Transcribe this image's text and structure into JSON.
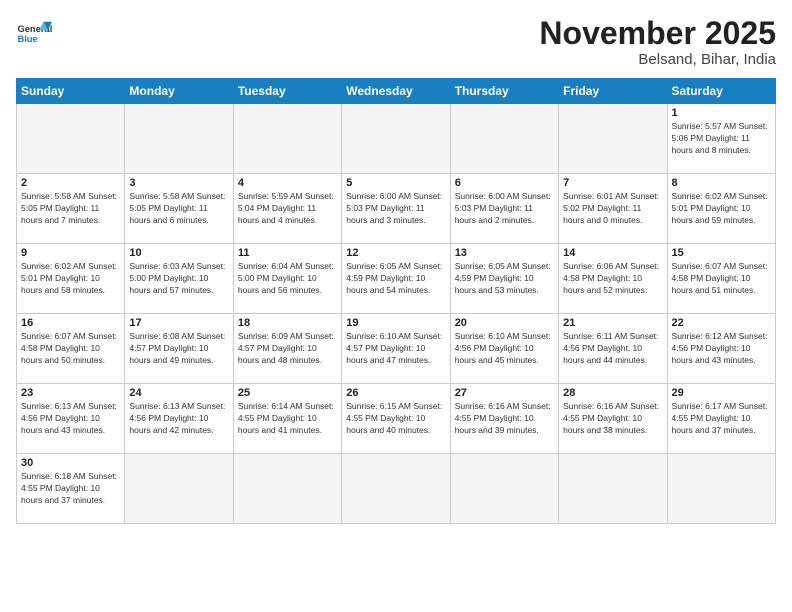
{
  "logo": {
    "general": "General",
    "blue": "Blue"
  },
  "title": "November 2025",
  "subtitle": "Belsand, Bihar, India",
  "days_of_week": [
    "Sunday",
    "Monday",
    "Tuesday",
    "Wednesday",
    "Thursday",
    "Friday",
    "Saturday"
  ],
  "weeks": [
    [
      {
        "day": "",
        "info": ""
      },
      {
        "day": "",
        "info": ""
      },
      {
        "day": "",
        "info": ""
      },
      {
        "day": "",
        "info": ""
      },
      {
        "day": "",
        "info": ""
      },
      {
        "day": "",
        "info": ""
      },
      {
        "day": "1",
        "info": "Sunrise: 5:57 AM\nSunset: 5:06 PM\nDaylight: 11 hours\nand 8 minutes."
      }
    ],
    [
      {
        "day": "2",
        "info": "Sunrise: 5:58 AM\nSunset: 5:05 PM\nDaylight: 11 hours\nand 7 minutes."
      },
      {
        "day": "3",
        "info": "Sunrise: 5:58 AM\nSunset: 5:05 PM\nDaylight: 11 hours\nand 6 minutes."
      },
      {
        "day": "4",
        "info": "Sunrise: 5:59 AM\nSunset: 5:04 PM\nDaylight: 11 hours\nand 4 minutes."
      },
      {
        "day": "5",
        "info": "Sunrise: 6:00 AM\nSunset: 5:03 PM\nDaylight: 11 hours\nand 3 minutes."
      },
      {
        "day": "6",
        "info": "Sunrise: 6:00 AM\nSunset: 5:03 PM\nDaylight: 11 hours\nand 2 minutes."
      },
      {
        "day": "7",
        "info": "Sunrise: 6:01 AM\nSunset: 5:02 PM\nDaylight: 11 hours\nand 0 minutes."
      },
      {
        "day": "8",
        "info": "Sunrise: 6:02 AM\nSunset: 5:01 PM\nDaylight: 10 hours\nand 59 minutes."
      }
    ],
    [
      {
        "day": "9",
        "info": "Sunrise: 6:02 AM\nSunset: 5:01 PM\nDaylight: 10 hours\nand 58 minutes."
      },
      {
        "day": "10",
        "info": "Sunrise: 6:03 AM\nSunset: 5:00 PM\nDaylight: 10 hours\nand 57 minutes."
      },
      {
        "day": "11",
        "info": "Sunrise: 6:04 AM\nSunset: 5:00 PM\nDaylight: 10 hours\nand 56 minutes."
      },
      {
        "day": "12",
        "info": "Sunrise: 6:05 AM\nSunset: 4:59 PM\nDaylight: 10 hours\nand 54 minutes."
      },
      {
        "day": "13",
        "info": "Sunrise: 6:05 AM\nSunset: 4:59 PM\nDaylight: 10 hours\nand 53 minutes."
      },
      {
        "day": "14",
        "info": "Sunrise: 6:06 AM\nSunset: 4:58 PM\nDaylight: 10 hours\nand 52 minutes."
      },
      {
        "day": "15",
        "info": "Sunrise: 6:07 AM\nSunset: 4:58 PM\nDaylight: 10 hours\nand 51 minutes."
      }
    ],
    [
      {
        "day": "16",
        "info": "Sunrise: 6:07 AM\nSunset: 4:58 PM\nDaylight: 10 hours\nand 50 minutes."
      },
      {
        "day": "17",
        "info": "Sunrise: 6:08 AM\nSunset: 4:57 PM\nDaylight: 10 hours\nand 49 minutes."
      },
      {
        "day": "18",
        "info": "Sunrise: 6:09 AM\nSunset: 4:57 PM\nDaylight: 10 hours\nand 48 minutes."
      },
      {
        "day": "19",
        "info": "Sunrise: 6:10 AM\nSunset: 4:57 PM\nDaylight: 10 hours\nand 47 minutes."
      },
      {
        "day": "20",
        "info": "Sunrise: 6:10 AM\nSunset: 4:56 PM\nDaylight: 10 hours\nand 45 minutes."
      },
      {
        "day": "21",
        "info": "Sunrise: 6:11 AM\nSunset: 4:56 PM\nDaylight: 10 hours\nand 44 minutes."
      },
      {
        "day": "22",
        "info": "Sunrise: 6:12 AM\nSunset: 4:56 PM\nDaylight: 10 hours\nand 43 minutes."
      }
    ],
    [
      {
        "day": "23",
        "info": "Sunrise: 6:13 AM\nSunset: 4:56 PM\nDaylight: 10 hours\nand 43 minutes."
      },
      {
        "day": "24",
        "info": "Sunrise: 6:13 AM\nSunset: 4:56 PM\nDaylight: 10 hours\nand 42 minutes."
      },
      {
        "day": "25",
        "info": "Sunrise: 6:14 AM\nSunset: 4:55 PM\nDaylight: 10 hours\nand 41 minutes."
      },
      {
        "day": "26",
        "info": "Sunrise: 6:15 AM\nSunset: 4:55 PM\nDaylight: 10 hours\nand 40 minutes."
      },
      {
        "day": "27",
        "info": "Sunrise: 6:16 AM\nSunset: 4:55 PM\nDaylight: 10 hours\nand 39 minutes."
      },
      {
        "day": "28",
        "info": "Sunrise: 6:16 AM\nSunset: 4:55 PM\nDaylight: 10 hours\nand 38 minutes."
      },
      {
        "day": "29",
        "info": "Sunrise: 6:17 AM\nSunset: 4:55 PM\nDaylight: 10 hours\nand 37 minutes."
      }
    ],
    [
      {
        "day": "30",
        "info": "Sunrise: 6:18 AM\nSunset: 4:55 PM\nDaylight: 10 hours\nand 37 minutes."
      },
      {
        "day": "",
        "info": ""
      },
      {
        "day": "",
        "info": ""
      },
      {
        "day": "",
        "info": ""
      },
      {
        "day": "",
        "info": ""
      },
      {
        "day": "",
        "info": ""
      },
      {
        "day": "",
        "info": ""
      }
    ]
  ]
}
